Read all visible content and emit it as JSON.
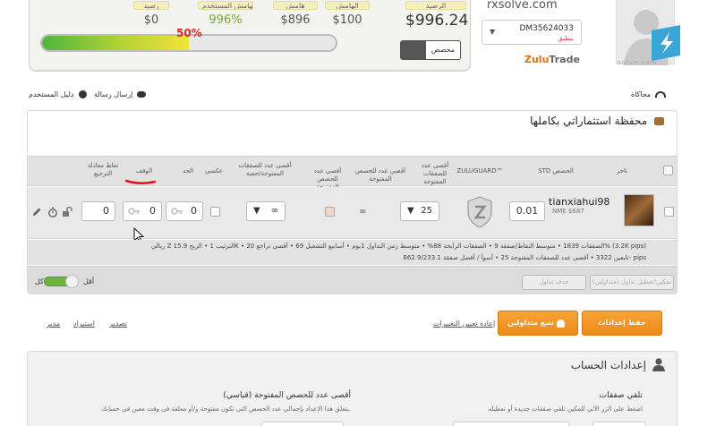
{
  "top_panel": {
    "stats": [
      {
        "label": "رصيد",
        "value": "$0"
      },
      {
        "label": "الهامش المستخدم",
        "value": "996%"
      },
      {
        "label": "هامش",
        "value": "$896"
      },
      {
        "label": "الهامش",
        "value": "$100"
      },
      {
        "label": "الرصيد",
        "value": "$996.24"
      }
    ],
    "progress_label": "50%",
    "progress_fraction": 0.5,
    "mode_toggle_label": "مخصص",
    "account_number": "DM35624033",
    "account_sub": "ينطبق",
    "site_top": "rxsolve.com",
    "brand_main": "Zulu",
    "brand_rest": "Trade",
    "site_bottom": "solve.com"
  },
  "links": {
    "simulation": "محاكاة",
    "send_message": "إرسال رسالة",
    "user_guide": "دليل المستخدم"
  },
  "portfolio": {
    "title": "محفظة استثماراتي بكاملها",
    "columns": {
      "trader": "تاجر",
      "std": "STD الحصص",
      "zuluguard": "ZULUGUARD™",
      "max_open_positions": "أقصى عدد للصفقات المفتوحة",
      "max_open_positions_shares": "أقصى عدد للحصص المفتوحة",
      "max_open_trades_shares": "أقصى عدد للصفقات المفتوحة/حصة",
      "inverse": "عكسي",
      "limit": "الحد",
      "stop": "الوقف",
      "points_return": "نقاط معادلة الترجيع"
    },
    "row": {
      "trader_name": "tianxiahui98",
      "trader_sub": "NME $687",
      "std_value": "0.01",
      "max_positions_value": "25",
      "infinity_1": "∞",
      "infinity_2": "∞",
      "limit_value": "0",
      "stop_value": "0",
      "points_value": "0"
    },
    "stats_line_1": "ريالي Z الترتيب 1 • الربح 15.9K • الصفقات 1839 • متوسط النقاط/صفقة 9 • الصفقات الرابحة 88% • متوسط زمن التداول 1يوم • أسابيع التشغيل 69 • أقصى تراجع 20% (3.2K pips)",
    "stats_line_2": "تابعين 3322 • أقصى عدد للصفقات المفتوحة 25 • أسوأ / أفضل صفقة 662.9/233.1- pips",
    "btn_edit": "تمكين/تعطيل تداول (متداولين)",
    "btn_delete": "حذف تداول",
    "toggle_left": "كل",
    "toggle_right": "أقل"
  },
  "actions": {
    "save": "حفظ إعدادات المتداول",
    "follow": "تتبع متداولين",
    "reset": "إعادة تعيين التغييرات",
    "export": "تصدير",
    "import": "استيراد",
    "manager": "مدير"
  },
  "settings": {
    "title": "إعدادات الحساب",
    "col1_title": "تلقي صفقات",
    "col1_desc": "اضغط على الزر الآتي للمكين تلقي صفقات جديدة أو تعطيله",
    "col2_title": "أقصى عدد للحصص المفتوحة (قياسي)",
    "col2_desc": "يتعلق هذا الإعداد بإجمالي عدد الحصص التي تكون مفتوحة و/أو معلقة في وقت معين في حسابك."
  }
}
